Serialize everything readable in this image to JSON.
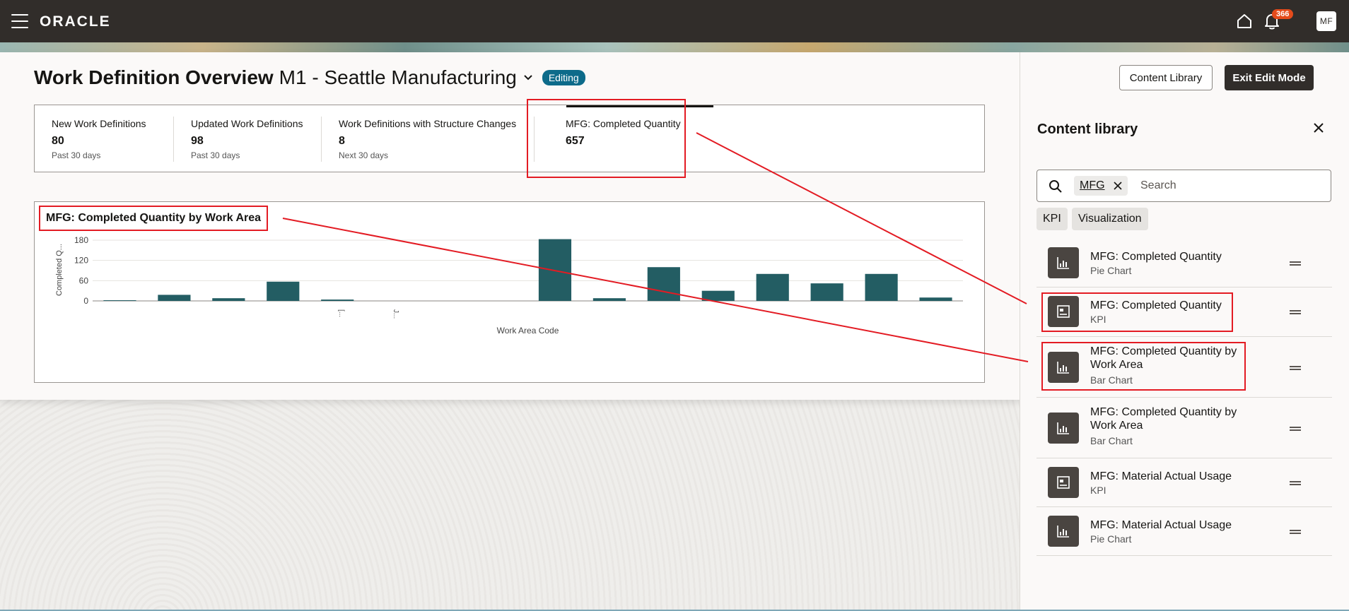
{
  "header": {
    "logo": "ORACLE",
    "notification_count": "366",
    "avatar_initials": "MF"
  },
  "page": {
    "title": "Work Definition Overview",
    "org": "M1 - Seattle Manufacturing",
    "editing_label": "Editing",
    "content_library_button": "Content Library",
    "exit_edit_button": "Exit Edit Mode"
  },
  "kpis": [
    {
      "label": "New Work Definitions",
      "value": "80",
      "sub": "Past 30 days"
    },
    {
      "label": "Updated Work Definitions",
      "value": "98",
      "sub": "Past 30 days"
    },
    {
      "label": "Work Definitions with Structure Changes",
      "value": "8",
      "sub": "Next 30 days"
    },
    {
      "label": "MFG: Completed Quantity",
      "value": "657",
      "sub": ""
    }
  ],
  "chart_data": {
    "type": "bar",
    "title": "MFG: Completed Quantity by Work Area",
    "xlabel": "Work Area Code",
    "ylabel": "Completed Q...",
    "ylim": [
      0,
      180
    ],
    "yticks": [
      "0",
      "60",
      "120",
      "180"
    ],
    "categories": [
      "",
      "",
      "",
      "",
      "[...",
      "J...",
      "",
      "",
      "",
      "",
      "",
      "",
      "",
      "",
      "",
      ""
    ],
    "values": [
      2,
      18,
      8,
      57,
      4,
      0,
      0,
      0,
      183,
      8,
      100,
      30,
      80,
      52,
      80,
      10
    ],
    "bar_color": "#235d63"
  },
  "panel": {
    "title": "Content library",
    "search_chip": "MFG",
    "search_placeholder": "Search",
    "filters": [
      "KPI",
      "Visualization"
    ],
    "items": [
      {
        "name": "MFG: Completed Quantity",
        "type": "Pie Chart",
        "icon": "chart-icon"
      },
      {
        "name": "MFG: Completed Quantity",
        "type": "KPI",
        "icon": "kpi-icon"
      },
      {
        "name": "MFG: Completed Quantity by Work Area",
        "type": "Bar Chart",
        "icon": "chart-icon"
      },
      {
        "name": "MFG: Completed Quantity by Work Area",
        "type": "Bar Chart",
        "icon": "chart-icon"
      },
      {
        "name": "MFG: Material Actual Usage",
        "type": "KPI",
        "icon": "kpi-icon"
      },
      {
        "name": "MFG: Material Actual Usage",
        "type": "Pie Chart",
        "icon": "chart-icon"
      }
    ]
  },
  "colors": {
    "annotation": "#e31b23",
    "header_bg": "#312d2a",
    "editing_badge": "#0d6b8a"
  }
}
